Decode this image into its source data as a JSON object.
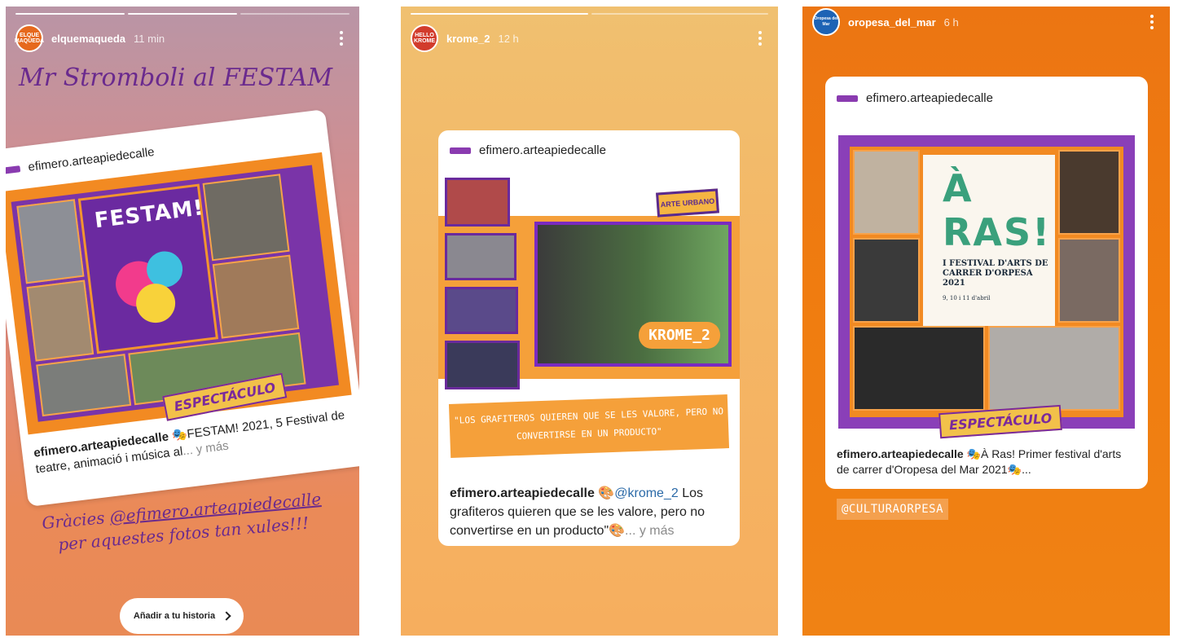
{
  "stories": [
    {
      "username": "elquemaqueda",
      "time": "11 min",
      "avatar_text": "ELQUE MAQUEDA",
      "caption_top": "Mr Stromboli al FESTAM",
      "post": {
        "user": "efimero.arteapiedecalle",
        "poster_title": "FESTAM!",
        "badge": "ESPECTÁCULO",
        "caption_text": " 🎭FESTAM! 2021, 5 Festival de teatre, animació i música al",
        "more": "... y más"
      },
      "caption_bottom_prefix": "Gràcies ",
      "caption_bottom_mention": "@efimero.arteapiedecalle",
      "caption_bottom_suffix": "per aquestes fotos tan xules!!!",
      "add_story_label": "Añadir a tu historia"
    },
    {
      "username": "krome_2",
      "time": "12 h",
      "avatar_text": "HELLO KROME",
      "post": {
        "user": "efimero.arteapiedecalle",
        "name_label": "KROME_2",
        "tag": "ARTE URBANO",
        "quote": "\"LOS GRAFITEROS QUIEREN QUE SE LES VALORE, PERO NO CONVERTIRSE EN UN PRODUCTO\"",
        "caption_emoji": " 🎨",
        "caption_mention": "@krome_2",
        "caption_text": " Los grafiteros quieren que se les valore, pero no convertirse en un producto\"🎨",
        "more": "... y más"
      }
    },
    {
      "username": "oropesa_del_mar",
      "time": "6 h",
      "avatar_text": "Oropesa del Mar",
      "post": {
        "user": "efimero.arteapiedecalle",
        "poster_title": "À RAS!",
        "poster_subtitle": "I FESTIVAL D'ARTS DE CARRER D'ORPESA 2021",
        "poster_dates": "9, 10 i 11 d'abril",
        "badge": "ESPECTÁCULO",
        "caption_text": " 🎭À Ras! Primer festival d'arts de carrer d'Oropesa del Mar 2021🎭..."
      },
      "tag": "@CULTURAORPESA"
    }
  ],
  "colors": {
    "accent_purple": "#7a2a9c",
    "accent_orange": "#f28a22",
    "story3_bg": "#f07d10"
  }
}
